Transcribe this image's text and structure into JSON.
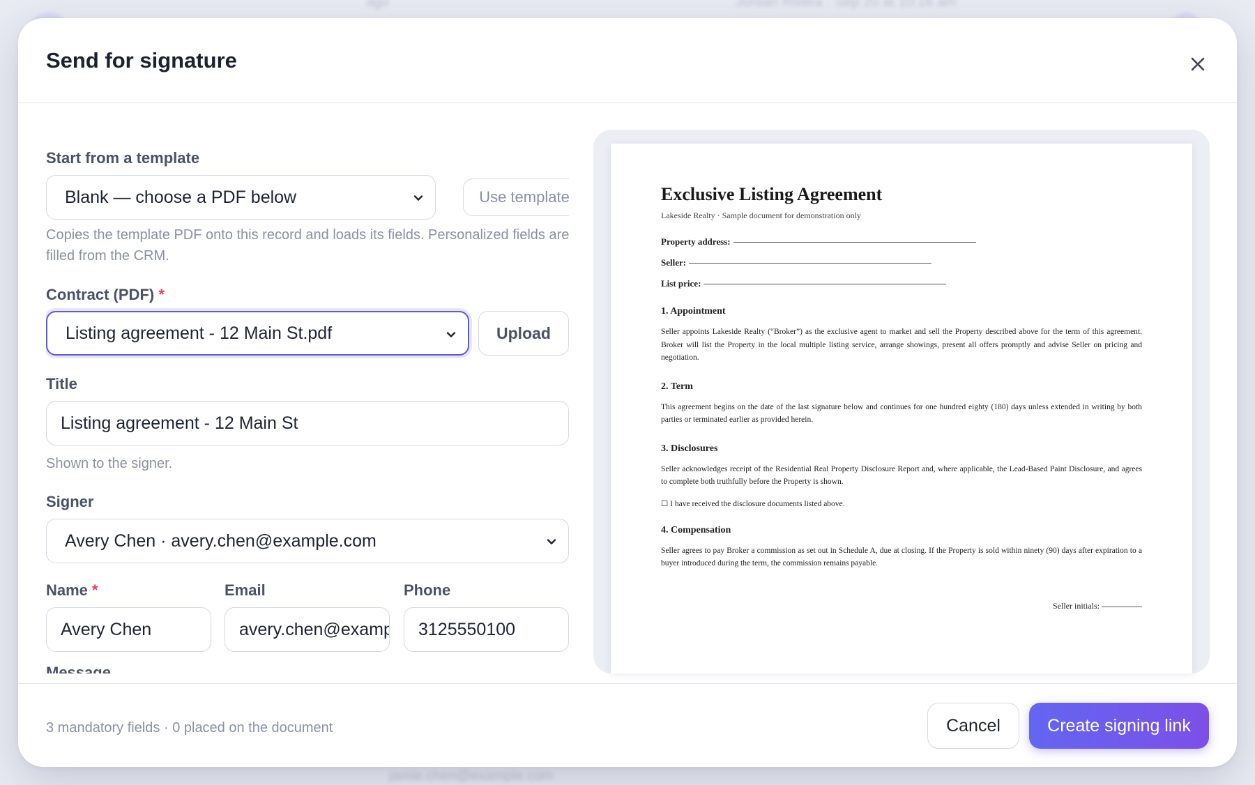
{
  "background": {
    "top_left_text": "ago",
    "top_right_text": "Jordan Rivera · Sep 20 at 10:16 am",
    "bottom_text": "jamie.chen@example.com"
  },
  "modal": {
    "title": "Send for signature",
    "close_icon": "close-icon"
  },
  "form": {
    "template": {
      "label": "Start from a template",
      "selected": "Blank — choose a PDF below",
      "button": "Use template",
      "hint": "Copies the template PDF onto this record and loads its fields. Personalized fields are filled from the CRM."
    },
    "contract": {
      "label": "Contract (PDF)",
      "required_mark": "*",
      "selected": "Listing agreement - 12 Main St.pdf",
      "button": "Upload"
    },
    "title": {
      "label": "Title",
      "value": "Listing agreement - 12 Main St",
      "hint": "Shown to the signer."
    },
    "signer": {
      "label": "Signer",
      "selected": "Avery Chen · avery.chen@example.com"
    },
    "name": {
      "label": "Name",
      "required_mark": "*",
      "value": "Avery Chen"
    },
    "email": {
      "label": "Email",
      "value": "avery.chen@example.com"
    },
    "phone": {
      "label": "Phone",
      "value": "3125550100"
    },
    "message": {
      "label": "Message"
    }
  },
  "document": {
    "title": "Exclusive Listing Agreement",
    "subtitle": "Lakeside Realty · Sample document for demonstration only",
    "property_label": "Property address:",
    "seller_label": "Seller:",
    "price_label": "List price:",
    "s1_heading": "1. Appointment",
    "s1_text": "Seller appoints Lakeside Realty (“Broker”) as the exclusive agent to market and sell the Property described above for the term of this agreement. Broker will list the Property in the local multiple listing service, arrange showings, present all offers promptly and advise Seller on pricing and negotiation.",
    "s2_heading": "2. Term",
    "s2_text": "This agreement begins on the date of the last signature below and continues for one hundred eighty (180) days unless extended in writing by both parties or terminated earlier as provided herein.",
    "s3_heading": "3. Disclosures",
    "s3_text": "Seller acknowledges receipt of the Residential Real Property Disclosure Report and, where applicable, the Lead-Based Paint Disclosure, and agrees to complete both truthfully before the Property is shown.",
    "checkbox_text": "☐ I have received the disclosure documents listed above.",
    "s4_heading": "4. Compensation",
    "s4_text": "Seller agrees to pay Broker a commission as set out in Schedule A, due at closing. If the Property is sold within ninety (90) days after expiration to a buyer introduced during the term, the commission remains payable.",
    "initials_label": "Seller initials:"
  },
  "footer": {
    "status": "3 mandatory fields · 0 placed on the document",
    "cancel": "Cancel",
    "primary": "Create signing link"
  },
  "colors": {
    "accent": "#6366f1",
    "accent_end": "#7c4fe8",
    "required": "#e0435b"
  }
}
